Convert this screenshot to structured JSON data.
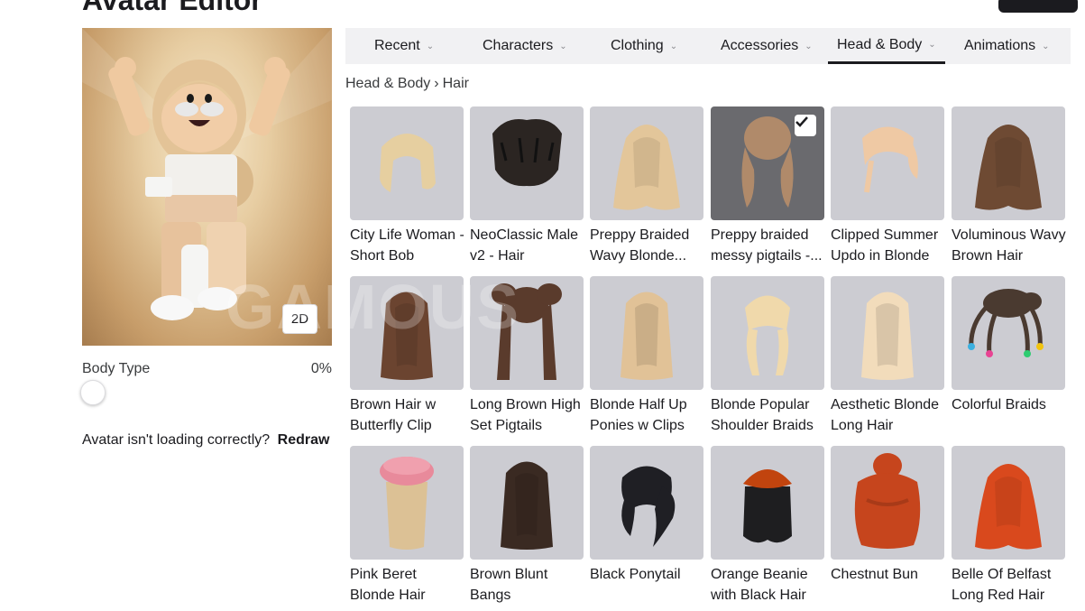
{
  "header": {
    "title": "Avatar Editor",
    "clipped_text": "( )"
  },
  "avatar": {
    "view_toggle_label": "2D",
    "body_type_label": "Body Type",
    "body_type_value": "0%",
    "body_type_level": 0,
    "redraw_prompt": "Avatar isn't loading correctly?",
    "redraw_label": "Redraw"
  },
  "tabs": [
    {
      "label": "Recent",
      "active": false
    },
    {
      "label": "Characters",
      "active": false
    },
    {
      "label": "Clothing",
      "active": false
    },
    {
      "label": "Accessories",
      "active": false
    },
    {
      "label": "Head & Body",
      "active": true
    },
    {
      "label": "Animations",
      "active": false
    }
  ],
  "breadcrumb": {
    "parent": "Head & Body",
    "separator": "›",
    "current": "Hair"
  },
  "items": [
    {
      "name": "City Life Woman - Short Bob",
      "hair_color": "#e6cfa0",
      "selected": false,
      "icon": "hair-short-bob-icon"
    },
    {
      "name": "NeoClassic Male v2 - Hair",
      "hair_color": "#2b2522",
      "selected": false,
      "icon": "hair-short-messy-icon"
    },
    {
      "name": "Preppy Braided Wavy Blonde...",
      "hair_color": "#e3c69a",
      "selected": false,
      "icon": "hair-long-wavy-icon"
    },
    {
      "name": "Preppy braided messy pigtails -...",
      "hair_color": "#b08a6a",
      "selected": true,
      "icon": "hair-pigtails-icon"
    },
    {
      "name": "Clipped Summer Updo in Blonde",
      "hair_color": "#efc9a4",
      "selected": false,
      "icon": "hair-updo-icon"
    },
    {
      "name": "Voluminous Wavy Brown Hair",
      "hair_color": "#6e4a33",
      "selected": false,
      "icon": "hair-long-wavy-icon"
    },
    {
      "name": "Brown Hair w Butterfly Clip",
      "hair_color": "#6b4430",
      "selected": false,
      "icon": "hair-long-straight-icon"
    },
    {
      "name": "Long Brown High Set Pigtails",
      "hair_color": "#5a3b2c",
      "selected": false,
      "icon": "hair-high-pigtails-icon"
    },
    {
      "name": "Blonde Half Up Ponies w Clips",
      "hair_color": "#e1c297",
      "selected": false,
      "icon": "hair-long-straight-icon"
    },
    {
      "name": "Blonde Popular Shoulder Braids",
      "hair_color": "#f0d9ab",
      "selected": false,
      "icon": "hair-braids-icon"
    },
    {
      "name": "Aesthetic Blonde Long Hair",
      "hair_color": "#f2dcbb",
      "selected": false,
      "icon": "hair-long-straight-icon"
    },
    {
      "name": "Colorful Braids",
      "hair_color": "#4a3a30",
      "selected": false,
      "icon": "hair-colorful-braids-icon"
    },
    {
      "name": "Pink Beret Blonde Hair",
      "hair_color": "#dcc195",
      "selected": false,
      "icon": "hair-beret-icon"
    },
    {
      "name": "Brown Blunt Bangs",
      "hair_color": "#3a2a22",
      "selected": false,
      "icon": "hair-long-straight-icon"
    },
    {
      "name": "Black Ponytail",
      "hair_color": "#1f1f24",
      "selected": false,
      "icon": "hair-ponytail-icon"
    },
    {
      "name": "Orange Beanie with Black Hair",
      "hair_color": "#1e1e20",
      "selected": false,
      "icon": "hair-beanie-icon"
    },
    {
      "name": "Chestnut Bun",
      "hair_color": "#c6451d",
      "selected": false,
      "icon": "hair-bun-icon"
    },
    {
      "name": "Belle Of Belfast Long Red Hair",
      "hair_color": "#d9491d",
      "selected": false,
      "icon": "hair-long-wavy-icon"
    }
  ]
}
